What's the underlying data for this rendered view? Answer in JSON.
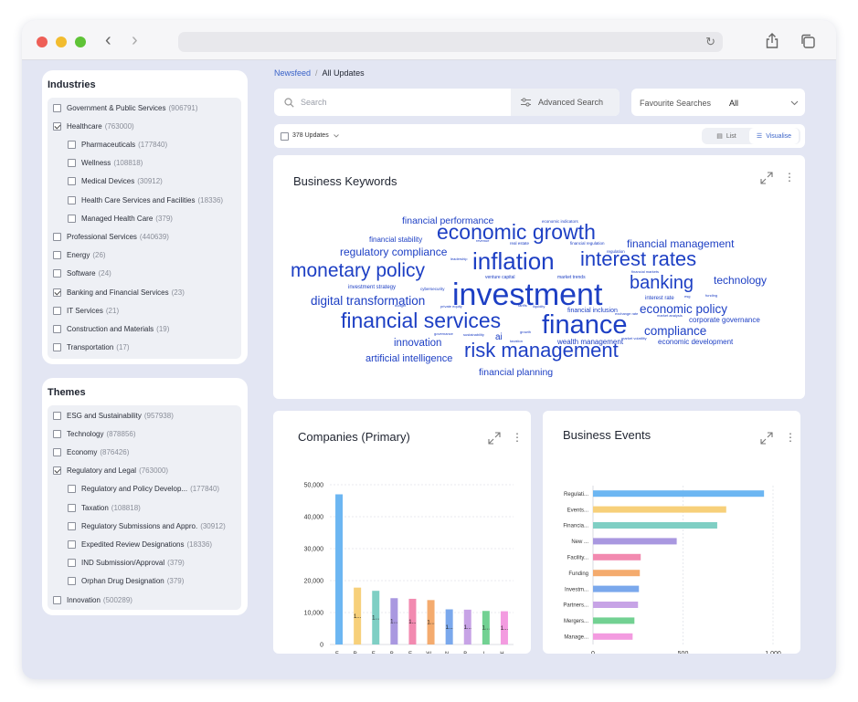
{
  "browser": {
    "icons": [
      "back-icon",
      "forward-icon",
      "reload-icon",
      "share-icon",
      "tabs-icon"
    ]
  },
  "filters": {
    "industries": {
      "title": "Industries",
      "items": [
        {
          "label": "Government & Public Services",
          "count": "(906791)",
          "checked": false,
          "level": 0
        },
        {
          "label": "Healthcare",
          "count": "(763000)",
          "checked": true,
          "level": 0
        },
        {
          "label": "Pharmaceuticals",
          "count": "(177840)",
          "checked": false,
          "level": 1
        },
        {
          "label": "Wellness",
          "count": "(108818)",
          "checked": false,
          "level": 1
        },
        {
          "label": "Medical Devices",
          "count": "(30912)",
          "checked": false,
          "level": 1
        },
        {
          "label": "Health Care Services and Facilities",
          "count": "(18336)",
          "checked": false,
          "level": 1
        },
        {
          "label": "Managed Health Care",
          "count": "(379)",
          "checked": false,
          "level": 1
        },
        {
          "label": "Professional Services",
          "count": "(440639)",
          "checked": false,
          "level": 0
        },
        {
          "label": "Energy",
          "count": "(26)",
          "checked": false,
          "level": 0
        },
        {
          "label": "Software",
          "count": "(24)",
          "checked": false,
          "level": 0
        },
        {
          "label": "Banking and Financial Services",
          "count": "(23)",
          "checked": true,
          "level": 0
        },
        {
          "label": "IT Services",
          "count": "(21)",
          "checked": false,
          "level": 0
        },
        {
          "label": "Construction and Materials",
          "count": "(19)",
          "checked": false,
          "level": 0
        },
        {
          "label": "Transportation",
          "count": "(17)",
          "checked": false,
          "level": 0
        }
      ]
    },
    "themes": {
      "title": "Themes",
      "items": [
        {
          "label": "ESG and Sustainability",
          "count": "(957938)",
          "checked": false,
          "level": 0
        },
        {
          "label": "Technology",
          "count": "(878856)",
          "checked": false,
          "level": 0
        },
        {
          "label": "Economy",
          "count": "(876426)",
          "checked": false,
          "level": 0
        },
        {
          "label": "Regulatory and Legal",
          "count": "(763000)",
          "checked": true,
          "level": 0
        },
        {
          "label": "Regulatory and Policy Develop...",
          "count": "(177840)",
          "checked": false,
          "level": 1
        },
        {
          "label": "Taxation",
          "count": "(108818)",
          "checked": false,
          "level": 1
        },
        {
          "label": "Regulatory Submissions and Appro.",
          "count": "(30912)",
          "checked": false,
          "level": 1
        },
        {
          "label": "Expedited Review Designations",
          "count": "(18336)",
          "checked": false,
          "level": 1
        },
        {
          "label": "IND Submission/Approval",
          "count": "(379)",
          "checked": false,
          "level": 1
        },
        {
          "label": "Orphan Drug Designation",
          "count": "(379)",
          "checked": false,
          "level": 1
        },
        {
          "label": "Innovation",
          "count": "(500289)",
          "checked": false,
          "level": 0
        }
      ]
    }
  },
  "breadcrumb": {
    "newsfeed": "Newsfeed",
    "separator": "/",
    "current": "All Updates"
  },
  "search": {
    "placeholder": "Search",
    "advanced_label": "Advanced Search"
  },
  "favourites": {
    "label": "Favourite Searches",
    "value": "All"
  },
  "updates": {
    "count_label": "378 Updates"
  },
  "view_toggle": {
    "list": "List",
    "visualise": "Visualise",
    "active": "visualise"
  },
  "colors": {
    "accent": "#3a63c8",
    "word": "#1d3fc4",
    "panel_bg": "#e3e6f3"
  },
  "keywords_card": {
    "title": "Business Keywords",
    "words": [
      {
        "text": "investment",
        "weight": 34
      },
      {
        "text": "finance",
        "weight": 29
      },
      {
        "text": "inflation",
        "weight": 26
      },
      {
        "text": "economic growth",
        "weight": 23
      },
      {
        "text": "financial services",
        "weight": 23
      },
      {
        "text": "interest rates",
        "weight": 22
      },
      {
        "text": "risk management",
        "weight": 22
      },
      {
        "text": "monetary policy",
        "weight": 21
      },
      {
        "text": "banking",
        "weight": 20
      },
      {
        "text": "digital transformation",
        "weight": 13.5
      },
      {
        "text": "economic policy",
        "weight": 13.5
      },
      {
        "text": "compliance",
        "weight": 13.5
      },
      {
        "text": "regulatory compliance",
        "weight": 12
      },
      {
        "text": "financial management",
        "weight": 12
      },
      {
        "text": "technology",
        "weight": 12
      },
      {
        "text": "innovation",
        "weight": 11.5
      },
      {
        "text": "artificial intelligence",
        "weight": 11
      },
      {
        "text": "financial performance",
        "weight": 10.5
      },
      {
        "text": "financial planning",
        "weight": 10.5
      },
      {
        "text": "ai",
        "weight": 10
      },
      {
        "text": "corporate governance",
        "weight": 8
      },
      {
        "text": "wealth management",
        "weight": 8
      },
      {
        "text": "economic development",
        "weight": 8
      },
      {
        "text": "financial stability",
        "weight": 8
      },
      {
        "text": "financial inclusion",
        "weight": 7
      },
      {
        "text": "investment strategy",
        "weight": 6
      },
      {
        "text": "interest rate",
        "weight": 6
      },
      {
        "text": "venture capital",
        "weight": 5
      },
      {
        "text": "market trends",
        "weight": 5
      },
      {
        "text": "cybersecurity",
        "weight": 4.5
      },
      {
        "text": "economic indicators",
        "weight": 4.5
      },
      {
        "text": "real estate",
        "weight": 4.5
      },
      {
        "text": "financial regulation",
        "weight": 4.5
      },
      {
        "text": "regulation",
        "weight": 4.5
      },
      {
        "text": "financial markets",
        "weight": 4
      },
      {
        "text": "market analysis",
        "weight": 4
      },
      {
        "text": "market volatility",
        "weight": 4
      },
      {
        "text": "exchange rate",
        "weight": 4
      },
      {
        "text": "funding",
        "weight": 4
      },
      {
        "text": "revenue",
        "weight": 4
      },
      {
        "text": "leadership",
        "weight": 4
      },
      {
        "text": "budget",
        "weight": 4
      },
      {
        "text": "private equity",
        "weight": 4
      },
      {
        "text": "tariffs",
        "weight": 4
      },
      {
        "text": "liquidity",
        "weight": 4
      },
      {
        "text": "governance",
        "weight": 4
      },
      {
        "text": "sustainability",
        "weight": 4
      },
      {
        "text": "growth",
        "weight": 4
      },
      {
        "text": "taxation",
        "weight": 4
      },
      {
        "text": "esg",
        "weight": 4
      }
    ]
  },
  "chart_data": [
    {
      "type": "bar",
      "title": "Companies (Primary)",
      "orientation": "vertical",
      "categories": [
        "F...",
        "R...",
        "E...",
        "B...",
        "E...",
        "W...",
        "N...",
        "B...",
        "I...",
        "H..."
      ],
      "values": [
        47000,
        17800,
        16800,
        14500,
        14300,
        13900,
        11000,
        10900,
        10500,
        10400
      ],
      "bar_labels": [
        "",
        "1...",
        "1...",
        "1...",
        "1...",
        "1...",
        "1...",
        "1...",
        "1...",
        "1..."
      ],
      "colors": [
        "#6cb6f2",
        "#f7d07a",
        "#7fcfc4",
        "#a998e0",
        "#f28ab0",
        "#f4ab6e",
        "#7aa8ec",
        "#c7a3e6",
        "#72d192",
        "#f39be0"
      ],
      "ylim": [
        0,
        50000
      ],
      "yticks": [
        "0",
        "10,000",
        "20,000",
        "30,000",
        "40,000",
        "50,000"
      ],
      "grid": true
    },
    {
      "type": "bar",
      "title": "Business Events",
      "orientation": "horizontal",
      "categories": [
        "Regulati...",
        "Events...",
        "Financia...",
        "New ...",
        "Facility...",
        "Funding",
        "Investm...",
        "Partners...",
        "Mergers...",
        "Manage..."
      ],
      "values": [
        950,
        740,
        690,
        465,
        265,
        260,
        255,
        250,
        230,
        220
      ],
      "colors": [
        "#6cb6f2",
        "#f7d07a",
        "#7fcfc4",
        "#a998e0",
        "#f28ab0",
        "#f4ab6e",
        "#7aa8ec",
        "#c7a3e6",
        "#72d192",
        "#f39be0"
      ],
      "xlim": [
        0,
        1000
      ],
      "xticks": [
        "0",
        "500",
        "1,000"
      ],
      "grid": true
    }
  ]
}
